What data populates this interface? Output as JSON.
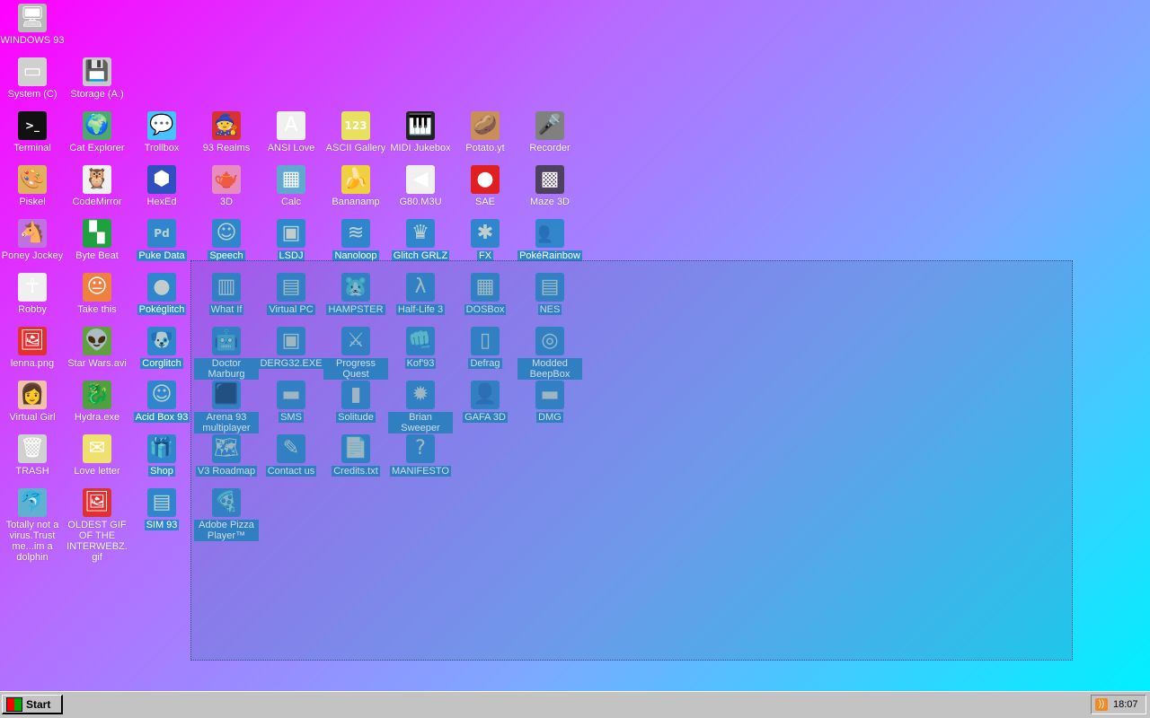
{
  "desktop": {
    "icons": [
      {
        "label": "WINDOWS 93",
        "glyph": "🖥",
        "bg": "#b8b8b8",
        "selected": false
      },
      {
        "label": "System (C)",
        "glyph": "▭",
        "bg": "#d0d0d0",
        "selected": false
      },
      {
        "label": "Storage (A:)",
        "glyph": "💾",
        "bg": "#c8c8c8",
        "selected": false
      },
      {
        "label": "Terminal",
        "glyph": ">_",
        "bg": "#111111",
        "selected": false
      },
      {
        "label": "Cat Explorer",
        "glyph": "🌍",
        "bg": "#4fa86b",
        "selected": false
      },
      {
        "label": "Trollbox",
        "glyph": "💬",
        "bg": "#46c2ff",
        "selected": false
      },
      {
        "label": "93 Realms",
        "glyph": "🧙",
        "bg": "#d63232",
        "selected": false
      },
      {
        "label": "ANSI Love",
        "glyph": "A",
        "bg": "#f0f0f0",
        "selected": false
      },
      {
        "label": "ASCII Gallery",
        "glyph": "123",
        "bg": "#e8e060",
        "selected": false
      },
      {
        "label": "MIDI Jukebox",
        "glyph": "🎹",
        "bg": "#222222",
        "selected": false
      },
      {
        "label": "Potato.yt",
        "glyph": "🥔",
        "bg": "#c89058",
        "selected": false
      },
      {
        "label": "Recorder",
        "glyph": "🎤",
        "bg": "#808080",
        "selected": false
      },
      {
        "label": "Piskel",
        "glyph": "🎨",
        "bg": "#e0b060",
        "selected": false
      },
      {
        "label": "CodeMirror",
        "glyph": "🦉",
        "bg": "#f0f0f0",
        "selected": false
      },
      {
        "label": "HexEd",
        "glyph": "⬢",
        "bg": "#3050c0",
        "selected": false
      },
      {
        "label": "3D",
        "glyph": "🫖",
        "bg": "#e88cc0",
        "selected": false
      },
      {
        "label": "Calc",
        "glyph": "▦",
        "bg": "#60a8d0",
        "selected": false
      },
      {
        "label": "Bananamp",
        "glyph": "🍌",
        "bg": "#f0d040",
        "selected": false
      },
      {
        "label": "G80.M3U",
        "glyph": "◀",
        "bg": "#f0f0f0",
        "selected": false
      },
      {
        "label": "SAE",
        "glyph": "●",
        "bg": "#e02020",
        "selected": false
      },
      {
        "label": "Maze 3D",
        "glyph": "▩",
        "bg": "#504060",
        "selected": false
      },
      {
        "label": "Poney Jockey",
        "glyph": "🐴",
        "bg": "#c070e0",
        "selected": false
      },
      {
        "label": "Byte Beat",
        "glyph": "▚",
        "bg": "#20a040",
        "selected": false
      },
      {
        "label": "Puke Data",
        "glyph": "Pd",
        "bg": "#3a8ad0",
        "selected": true
      },
      {
        "label": "Speech",
        "glyph": "☺",
        "bg": "#3a8ad0",
        "selected": true
      },
      {
        "label": "LSDJ",
        "glyph": "▣",
        "bg": "#3a8ad0",
        "selected": true
      },
      {
        "label": "Nanoloop",
        "glyph": "≋",
        "bg": "#3a8ad0",
        "selected": true
      },
      {
        "label": "Glitch GRLZ",
        "glyph": "♛",
        "bg": "#3a8ad0",
        "selected": true
      },
      {
        "label": "FX",
        "glyph": "✱",
        "bg": "#3a8ad0",
        "selected": true
      },
      {
        "label": "PokéRainbow",
        "glyph": "👥",
        "bg": "#3a8ad0",
        "selected": true
      },
      {
        "label": "Robby",
        "glyph": "☥",
        "bg": "#f0f0f0",
        "selected": false
      },
      {
        "label": "Take this",
        "glyph": "😐",
        "bg": "#f08040",
        "selected": false
      },
      {
        "label": "Pokéglitch",
        "glyph": "●",
        "bg": "#3a8ad0",
        "selected": true
      },
      {
        "label": "What If",
        "glyph": "▥",
        "bg": "#3a8ad0",
        "selected": true
      },
      {
        "label": "Virtual PC",
        "glyph": "▤",
        "bg": "#3a8ad0",
        "selected": true
      },
      {
        "label": "HAMPSTER",
        "glyph": "🐹",
        "bg": "#3a8ad0",
        "selected": true
      },
      {
        "label": "Half-Life 3",
        "glyph": "λ",
        "bg": "#3a8ad0",
        "selected": true
      },
      {
        "label": "DOSBox",
        "glyph": "▦",
        "bg": "#3a8ad0",
        "selected": true
      },
      {
        "label": "NES",
        "glyph": "▤",
        "bg": "#3a8ad0",
        "selected": true
      },
      {
        "label": "lenna.png",
        "glyph": "🖼",
        "bg": "#e03030",
        "selected": false
      },
      {
        "label": "Star Wars.avi",
        "glyph": "👽",
        "bg": "#60a040",
        "selected": false
      },
      {
        "label": "Corglitch",
        "glyph": "🐶",
        "bg": "#3a8ad0",
        "selected": true
      },
      {
        "label": "Doctor Marburg",
        "glyph": "🤖",
        "bg": "#3a8ad0",
        "selected": true
      },
      {
        "label": "DERG32.EXE",
        "glyph": "▣",
        "bg": "#3a8ad0",
        "selected": true
      },
      {
        "label": "Progress Quest",
        "glyph": "⚔",
        "bg": "#3a8ad0",
        "selected": true
      },
      {
        "label": "Kof'93",
        "glyph": "👊",
        "bg": "#3a8ad0",
        "selected": true
      },
      {
        "label": "Defrag",
        "glyph": "▯",
        "bg": "#3a8ad0",
        "selected": true
      },
      {
        "label": "Modded BeepBox",
        "glyph": "◎",
        "bg": "#3a8ad0",
        "selected": true
      },
      {
        "label": "Virtual Girl",
        "glyph": "👩",
        "bg": "#f0c0a8",
        "selected": false
      },
      {
        "label": "Hydra.exe",
        "glyph": "🐉",
        "bg": "#50a040",
        "selected": false
      },
      {
        "label": "Acid Box 93",
        "glyph": "☺",
        "bg": "#3a8ad0",
        "selected": true
      },
      {
        "label": "Arena 93 multiplayer",
        "glyph": "⬛",
        "bg": "#3a8ad0",
        "selected": true
      },
      {
        "label": "SMS",
        "glyph": "▬",
        "bg": "#3a8ad0",
        "selected": true
      },
      {
        "label": "Solitude",
        "glyph": "▮",
        "bg": "#3a8ad0",
        "selected": true
      },
      {
        "label": "Brian Sweeper",
        "glyph": "✹",
        "bg": "#3a8ad0",
        "selected": true
      },
      {
        "label": "GAFA 3D",
        "glyph": "👤",
        "bg": "#3a8ad0",
        "selected": true
      },
      {
        "label": "DMG",
        "glyph": "▬",
        "bg": "#3a8ad0",
        "selected": true
      },
      {
        "label": "TRASH",
        "glyph": "🗑",
        "bg": "#d0d0d0",
        "selected": false
      },
      {
        "label": "Love letter",
        "glyph": "✉",
        "bg": "#f0e070",
        "selected": false
      },
      {
        "label": "Shop",
        "glyph": "🎁",
        "bg": "#3a8ad0",
        "selected": true
      },
      {
        "label": "V3 Roadmap",
        "glyph": "🗺",
        "bg": "#3a8ad0",
        "selected": true
      },
      {
        "label": "Contact us",
        "glyph": "✎",
        "bg": "#3a8ad0",
        "selected": true
      },
      {
        "label": "Credits.txt",
        "glyph": "📄",
        "bg": "#3a8ad0",
        "selected": true
      },
      {
        "label": "MANIFESTO",
        "glyph": "?",
        "bg": "#3a8ad0",
        "selected": true
      },
      {
        "label": "Totally not a virus.Trust me...im a dolphin",
        "glyph": "🐬",
        "bg": "#60b0d0",
        "selected": false
      },
      {
        "label": "OLDEST GIF OF THE INTERWEBZ.gif",
        "glyph": "🖼",
        "bg": "#e03030",
        "selected": false
      },
      {
        "label": "SIM 93",
        "glyph": "▤",
        "bg": "#3a8ad0",
        "selected": true
      },
      {
        "label": "Adobe Pizza Player™",
        "glyph": "🍕",
        "bg": "#3a8ad0",
        "selected": true
      }
    ]
  },
  "taskbar": {
    "start_label": "Start",
    "clock": "18:07",
    "tray_icon": "rss-icon"
  }
}
